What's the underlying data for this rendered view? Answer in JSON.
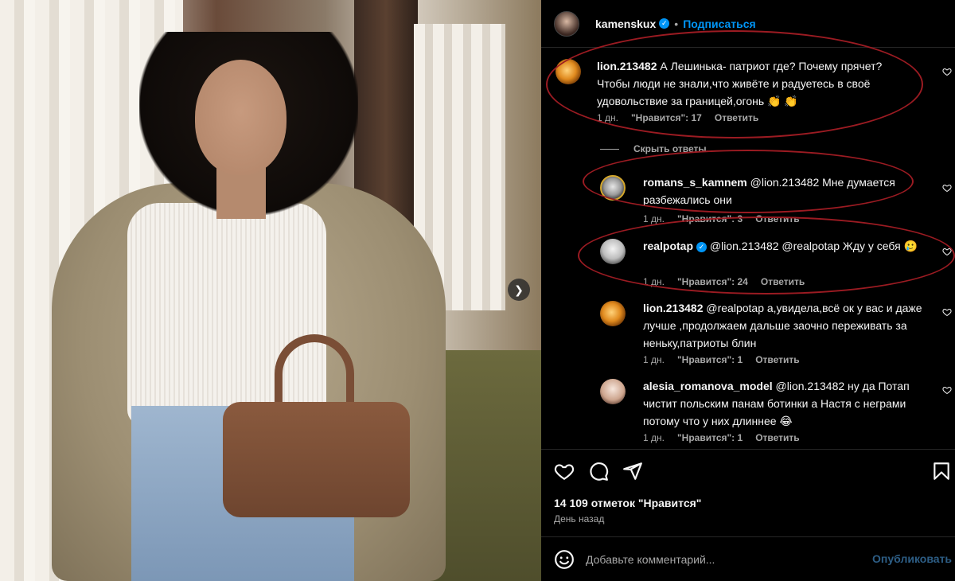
{
  "post": {
    "username": "kamenskux",
    "follow_label": "Подписаться",
    "dot": "•"
  },
  "comments": [
    {
      "user": "lion.213482",
      "text": "А Лешинька- патриот где? Почему прячет? Чтобы люди не знали,что живёте и радуетесь в своё удовольствие за границей,огонь 👏 👏",
      "time": "1 дн.",
      "likes": "\"Нравится\": 17",
      "reply": "Ответить"
    },
    {
      "user": "romans_s_kamnem",
      "text": "@lion.213482 Мне думается разбежались они",
      "time": "1 дн.",
      "likes": "\"Нравится\": 3",
      "reply": "Ответить"
    },
    {
      "user": "realpotap",
      "text": "@lion.213482 @realpotap Жду у себя 🥲",
      "time": "1 дн.",
      "likes": "\"Нравится\": 24",
      "reply": "Ответить"
    },
    {
      "user": "lion.213482",
      "text": "@realpotap а,увидела,всё ок у вас и даже лучше ,продолжаем дальше заочно переживать за неньку,патриоты блин",
      "time": "1 дн.",
      "likes": "\"Нравится\": 1",
      "reply": "Ответить"
    },
    {
      "user": "alesia_romanova_model",
      "text": "@lion.213482 ну да Потап чистит польским панам ботинки а Настя с неграми потому что у них длиннее 😂",
      "time": "1 дн.",
      "likes": "\"Нравится\": 1",
      "reply": "Ответить"
    }
  ],
  "hide_replies": "Скрыть ответы",
  "footer": {
    "likes_count": "14 109 отметок \"Нравится\"",
    "time_ago": "День назад",
    "comment_placeholder": "Добавьте комментарий...",
    "publish_label": "Опубликовать"
  },
  "icons": {
    "verified": "verified-badge-icon",
    "heart": "heart-icon",
    "comment": "comment-icon",
    "share": "share-icon",
    "save": "bookmark-icon",
    "emoji": "emoji-icon",
    "next": "chevron-right-icon"
  },
  "colors": {
    "accent": "#0095f6",
    "highlight": "#9b1b22",
    "background": "#000000",
    "muted": "#a8a8a8"
  }
}
